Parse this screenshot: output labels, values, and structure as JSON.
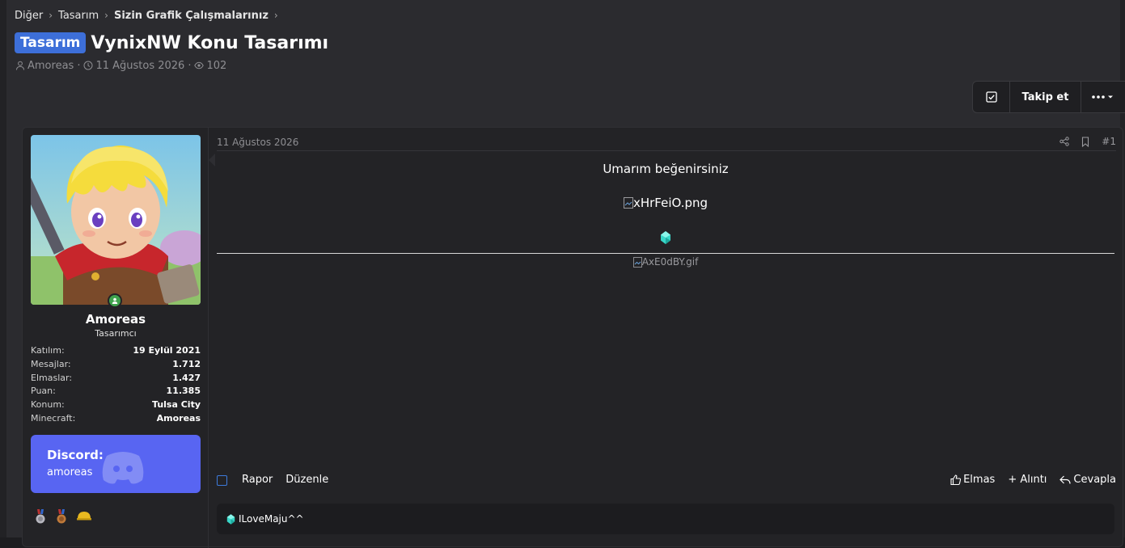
{
  "breadcrumb": [
    {
      "label": "Diğer",
      "bold": false
    },
    {
      "label": "Tasarım",
      "bold": false
    },
    {
      "label": "Sizin Grafik Çalışmalarınız",
      "bold": true
    }
  ],
  "thread": {
    "prefix": "Tasarım",
    "title": "VynixNW Konu Tasarımı",
    "author": "Amoreas",
    "date": "11 Ağustos 2026",
    "views": "102"
  },
  "toolbar": {
    "follow_label": "Takip et"
  },
  "user": {
    "name": "Amoreas",
    "title": "Tasarımcı",
    "stats": [
      {
        "key": "Katılım:",
        "value": "19 Eylül 2021"
      },
      {
        "key": "Mesajlar:",
        "value": "1.712"
      },
      {
        "key": "Elmaslar:",
        "value": "1.427"
      },
      {
        "key": "Puan:",
        "value": "11.385"
      },
      {
        "key": "Konum:",
        "value": "Tulsa City"
      },
      {
        "key": "Minecraft:",
        "value": "Amoreas"
      }
    ],
    "discord_label": "Discord:",
    "discord_value": "amoreas"
  },
  "post": {
    "date": "11 Ağustos 2026",
    "number": "#1",
    "text": "Umarım beğenirsiniz",
    "image1_alt": "xHrFeiO.png",
    "image2_alt": "AxE0dBY.gif",
    "signature": "ILoveMaju^^"
  },
  "actions": {
    "report": "Rapor",
    "edit": "Düzenle",
    "like": "Elmas",
    "quote": "+ Alıntı",
    "reply": "Cevapla"
  },
  "colors": {
    "accent": "#3d6fd9",
    "discord": "#5865f2",
    "online": "#3fa34d"
  }
}
